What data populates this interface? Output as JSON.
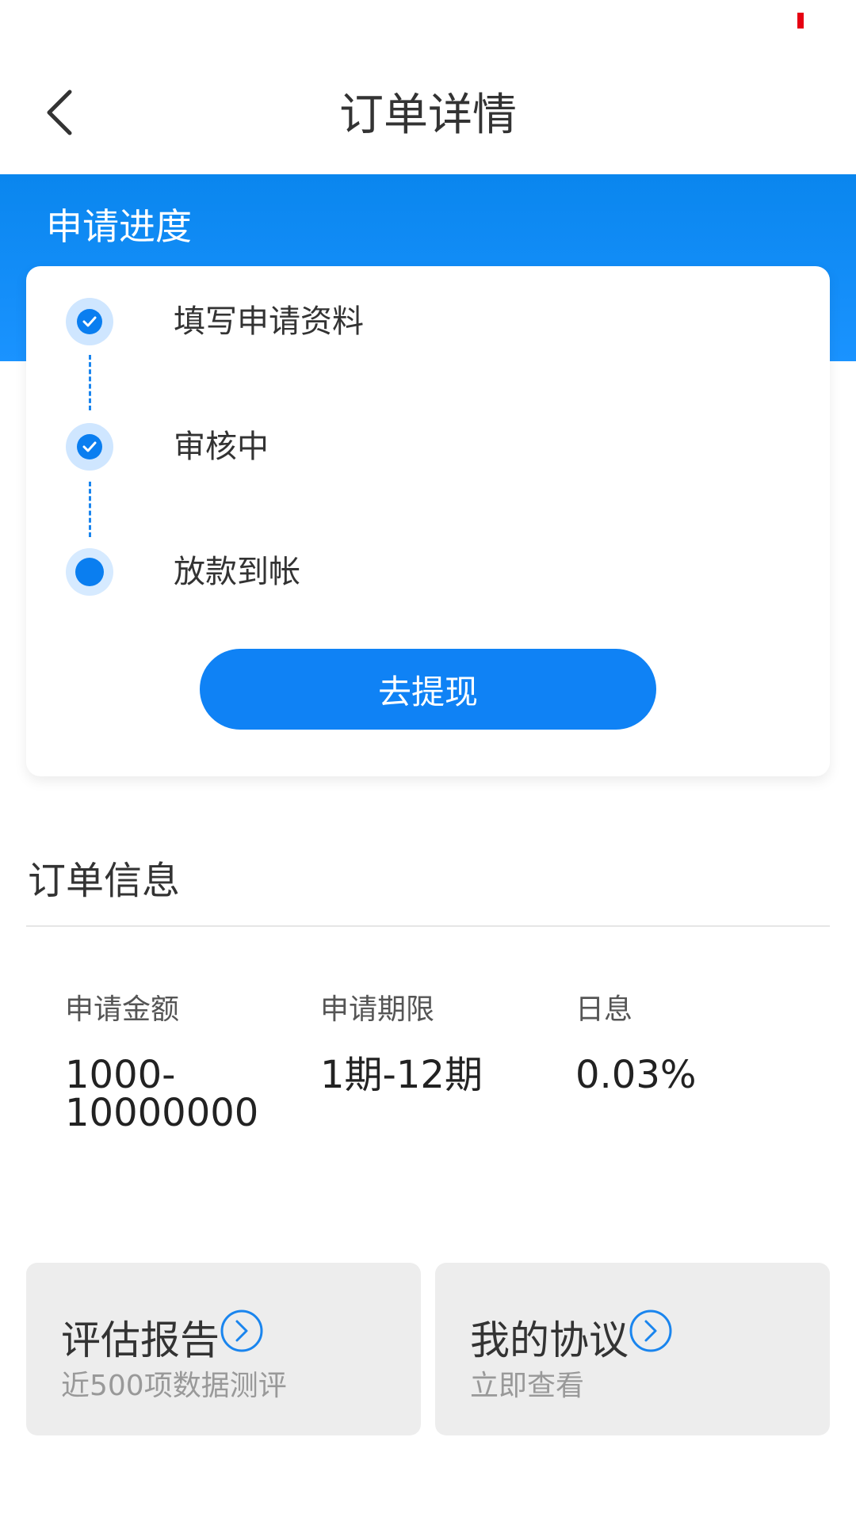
{
  "header": {
    "title": "订单详情"
  },
  "progress": {
    "heading": "申请进度",
    "steps": [
      {
        "label": "填写申请资料",
        "status": "done"
      },
      {
        "label": "审核中",
        "status": "done"
      },
      {
        "label": "放款到帐",
        "status": "current"
      }
    ],
    "action_label": "去提现"
  },
  "order_info": {
    "heading": "订单信息",
    "amount": {
      "label": "申请金额",
      "value": "1000-\n10000000"
    },
    "term": {
      "label": "申请期限",
      "value": "1期-12期"
    },
    "rate": {
      "label": "日息",
      "value": "0.03%"
    }
  },
  "cards": {
    "report": {
      "title": "评估报告",
      "subtitle": "近500项数据测评"
    },
    "agreement": {
      "title": "我的协议",
      "subtitle": "立即查看"
    }
  },
  "colors": {
    "brand_blue": "#0f82f5",
    "status_red": "#e60012"
  },
  "icons": {
    "back": "chevron-left-icon",
    "step_done": "check-icon",
    "card_arrow": "chevron-right-circle-icon"
  }
}
